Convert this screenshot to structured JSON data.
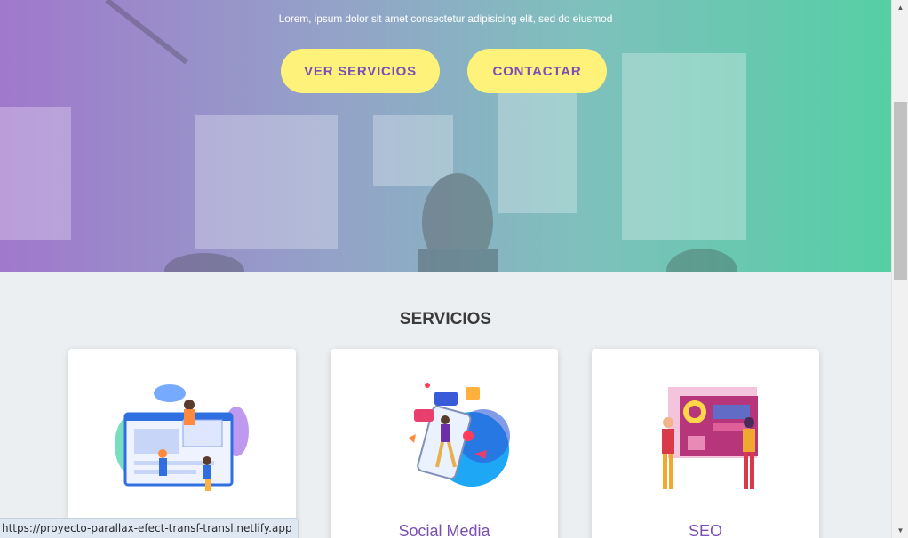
{
  "hero": {
    "subtitle": "Lorem, ipsum dolor sit amet consectetur adipisicing elit, sed do eiusmod",
    "buttons": {
      "services": "VER SERVICIOS",
      "contact": "CONTACTAR"
    },
    "colors": {
      "gradient_start": "#a078cc",
      "gradient_end": "#55cfa4",
      "button_bg": "#fff27a",
      "button_text": "#7a4fb6"
    }
  },
  "services": {
    "title": "SERVICIOS",
    "cards": [
      {
        "label": "",
        "illustration": "web-design-illustration"
      },
      {
        "label": "Social Media",
        "illustration": "social-media-illustration"
      },
      {
        "label": "SEO",
        "illustration": "seo-illustration"
      }
    ]
  },
  "status_bar": {
    "url": "https://proyecto-parallax-efect-transf-transl.netlify.app"
  },
  "scrollbar": {
    "up_icon": "chevron-up-icon",
    "down_icon": "chevron-down-icon"
  }
}
